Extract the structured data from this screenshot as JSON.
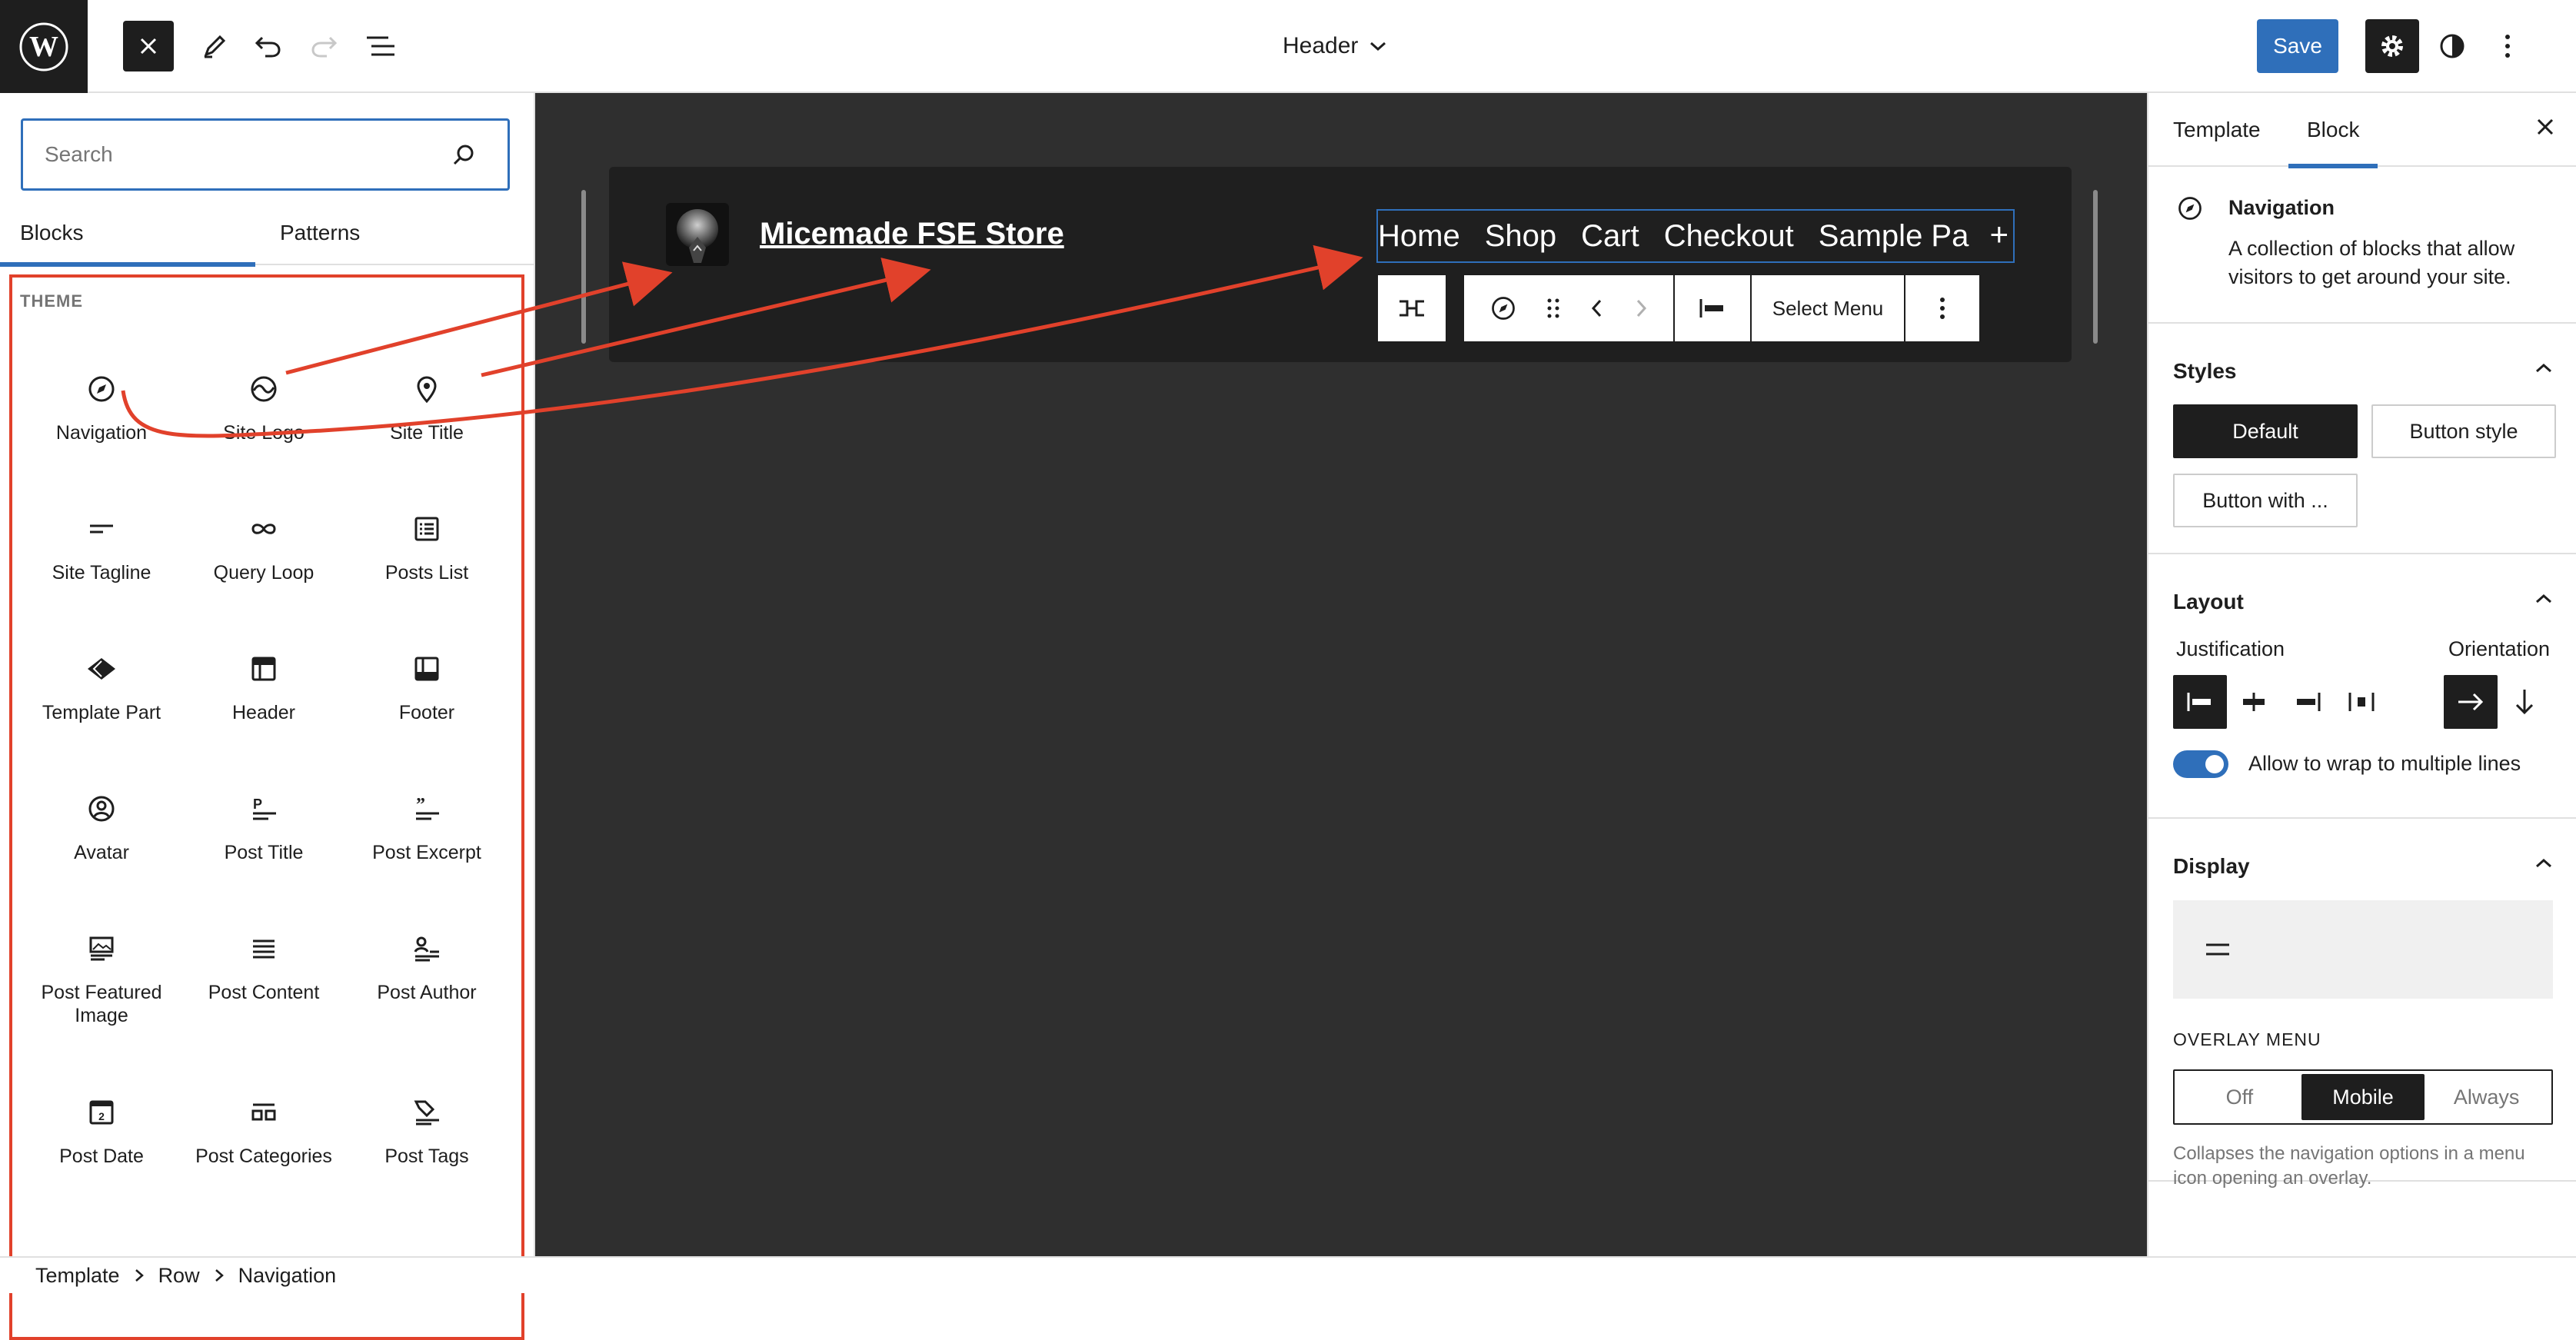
{
  "topbar": {
    "document_title": "Header",
    "save_label": "Save",
    "icons": [
      "wordpress-logo",
      "close-icon",
      "pencil-icon",
      "undo-icon",
      "redo-icon",
      "list-view-icon",
      "chevron-down-icon",
      "gear-icon",
      "contrast-icon",
      "kebab-icon"
    ]
  },
  "inserter": {
    "search_placeholder": "Search",
    "tabs": [
      "Blocks",
      "Patterns"
    ],
    "active_tab": "Blocks",
    "category_label": "THEME",
    "blocks": [
      {
        "label": "Navigation",
        "icon": "compass-icon"
      },
      {
        "label": "Site Logo",
        "icon": "site-logo-icon"
      },
      {
        "label": "Site Title",
        "icon": "map-pin-icon"
      },
      {
        "label": "Site Tagline",
        "icon": "tagline-icon"
      },
      {
        "label": "Query Loop",
        "icon": "loop-icon"
      },
      {
        "label": "Posts List",
        "icon": "posts-list-icon"
      },
      {
        "label": "Template Part",
        "icon": "template-part-icon"
      },
      {
        "label": "Header",
        "icon": "header-icon"
      },
      {
        "label": "Footer",
        "icon": "footer-icon"
      },
      {
        "label": "Avatar",
        "icon": "avatar-icon"
      },
      {
        "label": "Post Title",
        "icon": "post-title-icon"
      },
      {
        "label": "Post Excerpt",
        "icon": "post-excerpt-icon"
      },
      {
        "label": "Post Featured Image",
        "icon": "featured-image-icon"
      },
      {
        "label": "Post Content",
        "icon": "post-content-icon"
      },
      {
        "label": "Post Author",
        "icon": "post-author-icon"
      },
      {
        "label": "Post Date",
        "icon": "calendar-icon"
      },
      {
        "label": "Post Categories",
        "icon": "categories-icon"
      },
      {
        "label": "Post Tags",
        "icon": "tag-icon"
      }
    ],
    "calendar_day": "2"
  },
  "canvas": {
    "site_title": "Micemade FSE Store",
    "nav_links": [
      "Home",
      "Shop",
      "Cart",
      "Checkout",
      "Sample Pa"
    ],
    "nav_add_glyph": "+",
    "toolbar": {
      "select_menu_label": "Select Menu",
      "icons": [
        "transform-icon",
        "compass-icon",
        "drag-handle-icon",
        "chevron-left-icon",
        "chevron-right-icon",
        "justify-left-icon",
        "kebab-icon"
      ]
    }
  },
  "sidebar": {
    "tabs": [
      "Template",
      "Block"
    ],
    "active_tab": "Block",
    "block_card": {
      "title": "Navigation",
      "description": "A collection of blocks that allow visitors to get around your site."
    },
    "styles": {
      "title": "Styles",
      "options": [
        "Default",
        "Button style",
        "Button with ..."
      ],
      "active": "Default"
    },
    "layout": {
      "title": "Layout",
      "justification_label": "Justification",
      "orientation_label": "Orientation",
      "wrap_label": "Allow to wrap to multiple lines",
      "wrap_enabled": true
    },
    "display": {
      "title": "Display",
      "overlay_label": "OVERLAY MENU",
      "overlay_options": [
        "Off",
        "Mobile",
        "Always"
      ],
      "overlay_active": "Mobile",
      "overlay_help": "Collapses the navigation options in a menu icon opening an overlay."
    }
  },
  "breadcrumb": [
    "Template",
    "Row",
    "Navigation"
  ],
  "colors": {
    "accent": "#2f6fba",
    "annotation_red": "#e1412b",
    "dark": "#1e1e1e",
    "canvas_bg": "#2f2f2f"
  }
}
